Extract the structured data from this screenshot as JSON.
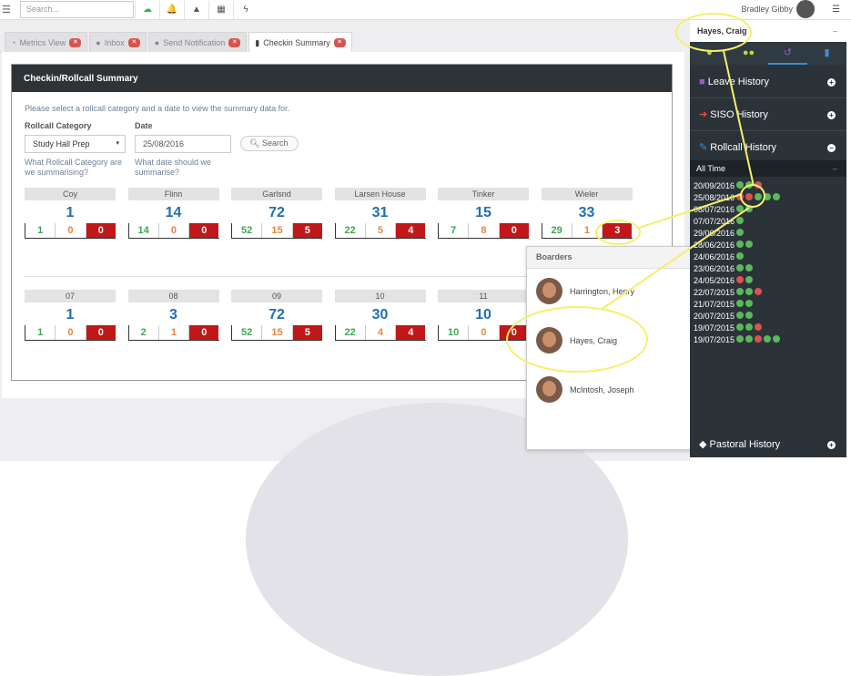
{
  "search": {
    "placeholder": "Search..."
  },
  "user": {
    "name": "Bradley Gibby"
  },
  "tabs": [
    {
      "label": "Metrics View"
    },
    {
      "label": "Inbox"
    },
    {
      "label": "Send Notification"
    },
    {
      "label": "Checkin Summary"
    }
  ],
  "panel": {
    "title": "Checkin/Rollcall Summary",
    "intro": "Please select a rollcall category and a date to view the summary data for.",
    "category_label": "Rollcall Category",
    "category_value": "Study Hall Prep",
    "category_help_1": "What Rollcall Category are",
    "category_help_2": "we summarising?",
    "date_label": "Date",
    "date_value": "25/08/2016",
    "date_help_1": "What date should we",
    "date_help_2": "summarise?",
    "search_label": "Search"
  },
  "groups1": [
    {
      "name": "Coy",
      "total": "1",
      "a": "1",
      "b": "0",
      "c": "0"
    },
    {
      "name": "Flinn",
      "total": "14",
      "a": "14",
      "b": "0",
      "c": "0"
    },
    {
      "name": "Garlsnd",
      "total": "72",
      "a": "52",
      "b": "15",
      "c": "5"
    },
    {
      "name": "Larsen House",
      "total": "31",
      "a": "22",
      "b": "5",
      "c": "4"
    },
    {
      "name": "Tinker",
      "total": "15",
      "a": "7",
      "b": "8",
      "c": "0"
    },
    {
      "name": "Wieler",
      "total": "33",
      "a": "29",
      "b": "1",
      "c": "3"
    }
  ],
  "groups2": [
    {
      "name": "07",
      "total": "1",
      "a": "1",
      "b": "0",
      "c": "0"
    },
    {
      "name": "08",
      "total": "3",
      "a": "2",
      "b": "1",
      "c": "0"
    },
    {
      "name": "09",
      "total": "72",
      "a": "52",
      "b": "15",
      "c": "5"
    },
    {
      "name": "10",
      "total": "30",
      "a": "22",
      "b": "4",
      "c": "4"
    },
    {
      "name": "11",
      "total": "10",
      "a": "10",
      "b": "0",
      "c": "0"
    }
  ],
  "popup": {
    "title": "Boarders",
    "people": [
      "Harrington, Henry",
      "Hayes, Craig",
      "McIntosh, Joseph"
    ]
  },
  "sidebar": {
    "student": "Hayes, Craig",
    "items": [
      "Leave History",
      "SISO History",
      "Rollcall History",
      "Pastoral History"
    ],
    "alltime": "All Time",
    "dates": [
      "20/09/2016",
      "25/08/2016",
      "08/07/2016",
      "07/07/2016",
      "29/06/2016",
      "28/06/2016",
      "24/06/2016",
      "23/06/2016",
      "24/05/2016",
      "22/07/2015",
      "21/07/2015",
      "20/07/2015",
      "19/07/2015",
      "19/07/2015"
    ]
  }
}
